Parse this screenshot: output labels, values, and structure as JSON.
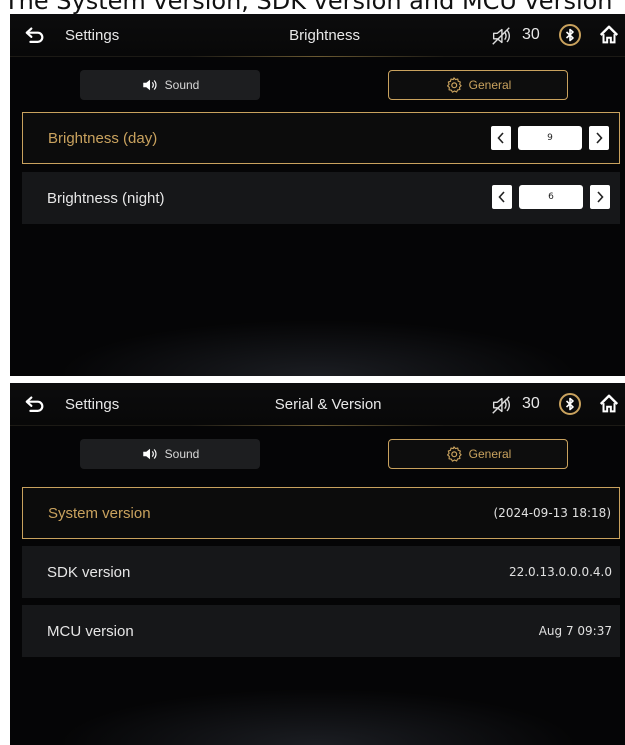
{
  "caption": "The System version, SDK version and MCU version",
  "screens": [
    {
      "statusbar": {
        "settings_label": "Settings",
        "title": "Brightness",
        "volume": "30"
      },
      "tabs": {
        "sound": "Sound",
        "general": "General"
      },
      "rows": [
        {
          "label": "Brightness (day)",
          "value": "9"
        },
        {
          "label": "Brightness (night)",
          "value": "6"
        }
      ]
    },
    {
      "statusbar": {
        "settings_label": "Settings",
        "title": "Serial & Version",
        "volume": "30"
      },
      "tabs": {
        "sound": "Sound",
        "general": "General"
      },
      "rows": [
        {
          "label": "System version",
          "value": "(2024-09-13 18:18)"
        },
        {
          "label": "SDK version",
          "value": "22.0.13.0.0.0.4.0"
        },
        {
          "label": "MCU version",
          "value": "Aug 7 09:37"
        }
      ]
    }
  ],
  "colors": {
    "accent": "#c9a25e",
    "background": "#050506",
    "row": "#161719"
  },
  "icons": [
    "back-arrow-icon",
    "volume-muted-icon",
    "bluetooth-icon",
    "home-icon",
    "speaker-icon",
    "gear-icon",
    "chevron-left-icon",
    "chevron-right-icon"
  ]
}
